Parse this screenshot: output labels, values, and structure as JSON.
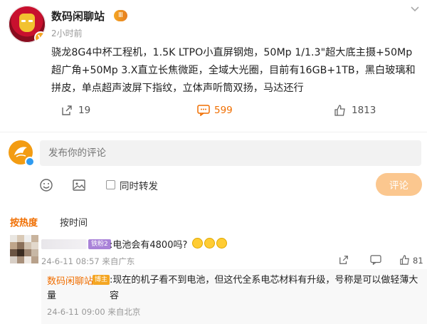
{
  "post": {
    "author": "数码闲聊站",
    "level_badge": "Ⅲ",
    "verified_badge": "V",
    "time": "2小时前",
    "text": "骁龙8G4中杯工程机，1.5K LTPO小直屏钢炮，50Mp 1/1.3\"超大底主摄+50Mp超广角+50Mp 3.X直立长焦微距，全域大光圈，目前有16GB+1TB，黑白玻璃和拼皮，单点超声波屏下指纹，立体声听筒双扬，马达还行",
    "more_icon": "chevron-down-icon"
  },
  "actions": {
    "repost_count": "19",
    "comment_count": "599",
    "like_count": "1813"
  },
  "composer": {
    "placeholder": "发布你的评论",
    "repost_label": "同时转发",
    "submit_label": "评论"
  },
  "tabs": {
    "hot": "按热度",
    "time": "按时间"
  },
  "comments": [
    {
      "badge": "铁粉2",
      "text": ":电池会有4800吗?",
      "meta": "24-6-11 08:57 来自广东",
      "likes": "81"
    }
  ],
  "reply": {
    "user": "数码闲聊站",
    "badge": "博主",
    "text_line1": ":现在的机子看不到电池，但这代全系电芯材料有升级，号称是可以做轻薄大容",
    "text_line2": "量",
    "meta": "24-6-11 09:00 来自北京"
  },
  "colors": {
    "accent": "#f06e00",
    "submit_bg": "#fbc78f"
  }
}
